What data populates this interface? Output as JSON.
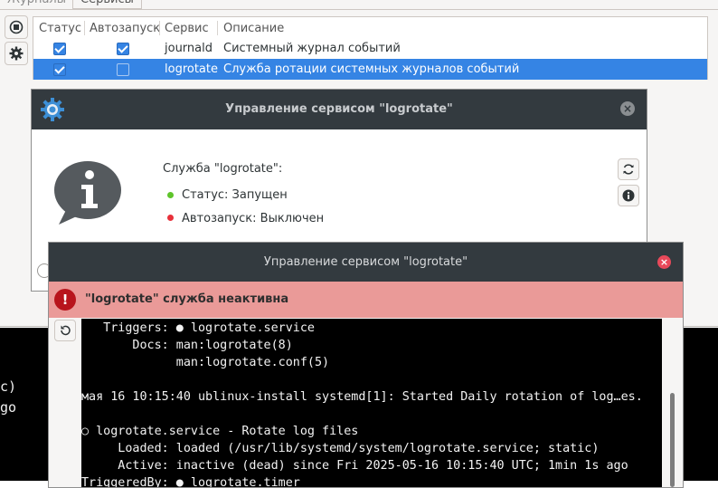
{
  "tabs": [
    {
      "label": "Журналы"
    },
    {
      "label": "Сервисы"
    }
  ],
  "table": {
    "headers": [
      "Статус",
      "Автозапуск",
      "Сервис",
      "Описание"
    ],
    "rows": [
      {
        "status": true,
        "autostart": true,
        "service": "journald",
        "description": "Системный журнал событий"
      },
      {
        "status": true,
        "autostart": false,
        "service": "logrotate",
        "description": "Служба ротации системных журналов событий"
      }
    ]
  },
  "background_terminal": {
    "lines": [
      "c)",
      "go"
    ]
  },
  "dialog1": {
    "title": "Управление сервисом \"logrotate\"",
    "service_label": "Служба \"logrotate\":",
    "status_text": "Статус: Запущен",
    "autostart_text": "Автозапуск: Выключен",
    "colors": {
      "status_dot": "#5ec42b",
      "autostart_dot": "#e8303a"
    }
  },
  "dialog2": {
    "title": "Управление сервисом \"logrotate\"",
    "alert": "\"logrotate\" служба неактивна",
    "terminal_lines": [
      "   Triggers: ● logrotate.service",
      "       Docs: man:logrotate(8)",
      "             man:logrotate.conf(5)",
      "",
      "мая 16 10:15:40 ublinux-install systemd[1]: Started Daily rotation of log…es.",
      "",
      "○ logrotate.service - Rotate log files",
      "     Loaded: loaded (/usr/lib/systemd/system/logrotate.service; static)",
      "     Active: inactive (dead) since Fri 2025-05-16 10:15:40 UTC; 1min 1s ago",
      "TriggeredBy: ● logrotate.timer"
    ]
  }
}
